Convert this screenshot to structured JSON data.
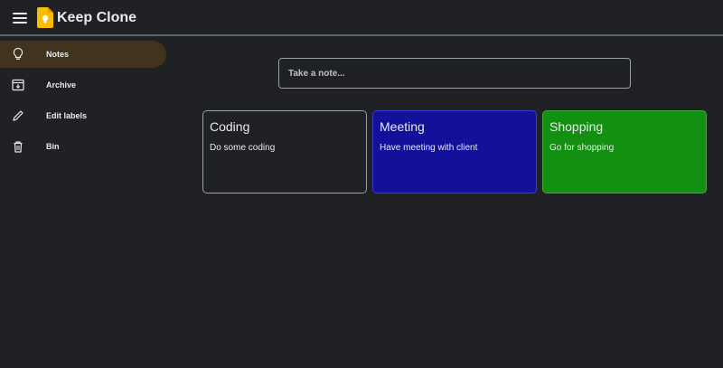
{
  "app": {
    "title": "Keep Clone",
    "brand_color": "#fbbc04"
  },
  "header": {
    "menu_icon": "hamburger-menu-icon",
    "logo_icon": "keep-bulb-icon"
  },
  "sidebar": {
    "items": [
      {
        "label": "Notes",
        "icon": "lightbulb-icon",
        "active": true
      },
      {
        "label": "Archive",
        "icon": "archive-icon",
        "active": false
      },
      {
        "label": "Edit labels",
        "icon": "pencil-icon",
        "active": false
      },
      {
        "label": "Bin",
        "icon": "trash-icon",
        "active": false
      }
    ],
    "active_color": "#41331c"
  },
  "composer": {
    "placeholder": "Take a note..."
  },
  "notes": [
    {
      "title": "Coding",
      "body": "Do some coding",
      "color": "#202124",
      "border": "#9aa0a6"
    },
    {
      "title": "Meeting",
      "body": "Have meeting with client",
      "color": "#13119a",
      "border": "#3d3bd6"
    },
    {
      "title": "Shopping",
      "body": "Go for shopping",
      "color": "#138f12",
      "border": "#37b236"
    }
  ]
}
